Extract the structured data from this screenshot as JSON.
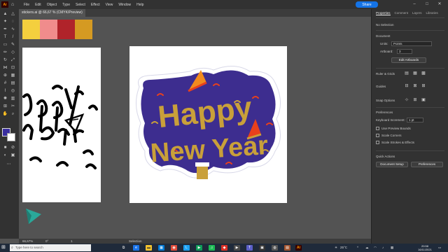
{
  "menubar": {
    "logo": "Ai",
    "items": [
      "File",
      "Edit",
      "Object",
      "Type",
      "Select",
      "Effect",
      "View",
      "Window",
      "Help"
    ],
    "share_label": "Share"
  },
  "document": {
    "tab_title": "stickers.ai @ 66,67 % (CMYK/Preview)"
  },
  "colors": {
    "chips": [
      "#f4cf3e",
      "#f08c8c",
      "#b0232a",
      "#d59a22"
    ],
    "purple": "#3d2d8f",
    "gold": "#c9a03a",
    "red_orange": "#e8401c",
    "orange": "#f28a1e",
    "teal": "#2aa89a"
  },
  "artwork": {
    "word1": "Happy",
    "word2": "New Year"
  },
  "status": {
    "zoom": "66,67%",
    "rotation": "0°",
    "page": "1",
    "mode": "Selection"
  },
  "panel": {
    "tabs": [
      "Properties",
      "Comment",
      "Layers",
      "Libraries"
    ],
    "no_selection": "No Selection",
    "document_label": "Document",
    "units_label": "Units:",
    "units_value": "Points",
    "artboard_label": "Artboard:",
    "artboard_value": "3",
    "edit_artboards": "Edit Artboards",
    "rulers_grids": "Ruler & Grids",
    "guides": "Guides",
    "snap_options": "Snap Options",
    "preferences_label": "Preferences",
    "keyboard_increment_label": "Keyboard Increment:",
    "keyboard_increment_value": "1 pt",
    "use_preview_bounds": "Use Preview Bounds",
    "scale_corners": "Scale Corners",
    "scale_strokes": "Scale Strokes & Effects",
    "quick_actions": "Quick Actions",
    "document_setup": "Document Setup",
    "preferences_btn": "Preferences"
  },
  "taskbar": {
    "search_placeholder": "Type here to search",
    "weather": "25°C",
    "time": "20:58",
    "date": "16/11/2021"
  }
}
